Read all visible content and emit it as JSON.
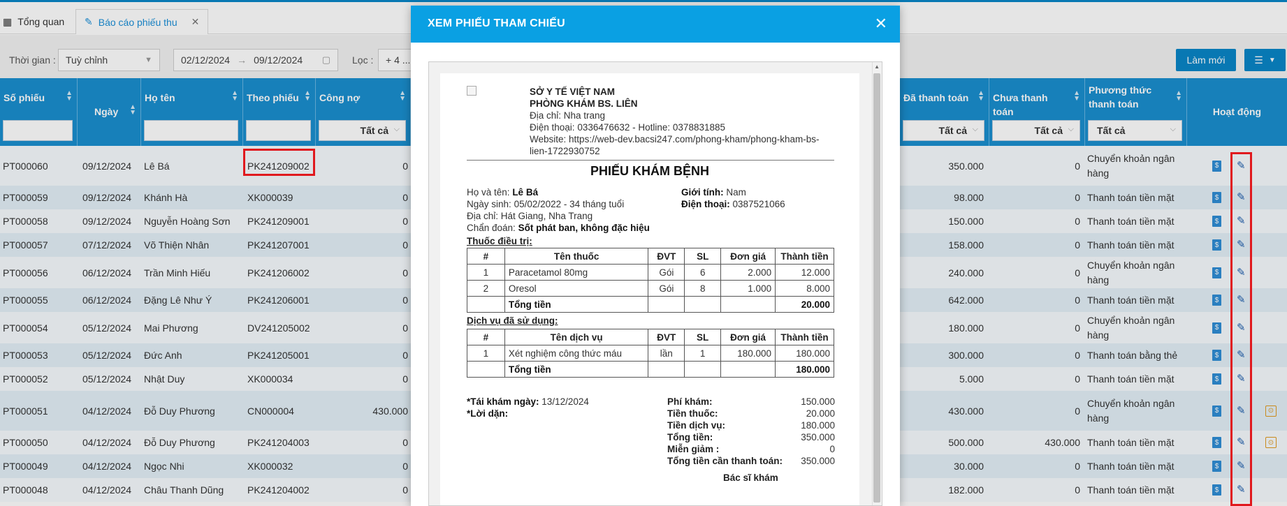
{
  "tabs": [
    {
      "label": "Tổng quan",
      "icon": "dashboard-icon"
    },
    {
      "label": "Báo cáo phiếu thu",
      "icon": "report-icon"
    }
  ],
  "filters": {
    "time_label": "Thời gian :",
    "time_value": "Tuỳ chỉnh",
    "date_from": "02/12/2024",
    "date_to": "09/12/2024",
    "filter_label": "Lọc :",
    "filter_value": "+ 4 ...",
    "refresh_label": "Làm mới"
  },
  "columns": [
    {
      "label": "Số phiếu"
    },
    {
      "label": "Ngày"
    },
    {
      "label": "Họ tên"
    },
    {
      "label": "Theo phiếu"
    },
    {
      "label": "Công nợ",
      "filter": "Tất cả"
    },
    {
      "label": "Đã thanh toán",
      "filter": "Tất cả"
    },
    {
      "label": "Chưa thanh toán",
      "filter": "Tất cả"
    },
    {
      "label": "Phương thức thanh toán",
      "filter": "Tất cả"
    },
    {
      "label": "Hoạt động"
    }
  ],
  "rows": [
    {
      "so": "PT000060",
      "ngay": "09/12/2024",
      "ten": "Lê Bá",
      "theo": "PK241209002",
      "congno": "0",
      "datt": "350.000",
      "chuatt": "0",
      "pt": "Chuyển khoản ngân hàng",
      "extra": false
    },
    {
      "so": "PT000059",
      "ngay": "09/12/2024",
      "ten": "Khánh Hà",
      "theo": "XK000039",
      "congno": "0",
      "datt": "98.000",
      "chuatt": "0",
      "pt": "Thanh toán tiền mặt",
      "extra": false
    },
    {
      "so": "PT000058",
      "ngay": "09/12/2024",
      "ten": "Nguyễn Hoàng Sơn",
      "theo": "PK241209001",
      "congno": "0",
      "datt": "150.000",
      "chuatt": "0",
      "pt": "Thanh toán tiền mặt",
      "extra": false
    },
    {
      "so": "PT000057",
      "ngay": "07/12/2024",
      "ten": "Võ Thiện Nhân",
      "theo": "PK241207001",
      "congno": "0",
      "datt": "158.000",
      "chuatt": "0",
      "pt": "Thanh toán tiền mặt",
      "extra": false
    },
    {
      "so": "PT000056",
      "ngay": "06/12/2024",
      "ten": "Trần Minh Hiếu",
      "theo": "PK241206002",
      "congno": "0",
      "datt": "240.000",
      "chuatt": "0",
      "pt": "Chuyển khoản ngân hàng",
      "extra": false
    },
    {
      "so": "PT000055",
      "ngay": "06/12/2024",
      "ten": "Đặng Lê Như Ý",
      "theo": "PK241206001",
      "congno": "0",
      "datt": "642.000",
      "chuatt": "0",
      "pt": "Thanh toán tiền mặt",
      "extra": false
    },
    {
      "so": "PT000054",
      "ngay": "05/12/2024",
      "ten": "Mai Phương",
      "theo": "DV241205002",
      "congno": "0",
      "datt": "180.000",
      "chuatt": "0",
      "pt": "Chuyển khoản ngân hàng",
      "extra": false
    },
    {
      "so": "PT000053",
      "ngay": "05/12/2024",
      "ten": "Đức Anh",
      "theo": "PK241205001",
      "congno": "0",
      "datt": "300.000",
      "chuatt": "0",
      "pt": "Thanh toán bằng thẻ",
      "extra": false
    },
    {
      "so": "PT000052",
      "ngay": "05/12/2024",
      "ten": "Nhật Duy",
      "theo": "XK000034",
      "congno": "0",
      "datt": "5.000",
      "chuatt": "0",
      "pt": "Thanh toán tiền mặt",
      "extra": false
    },
    {
      "so": "PT000051",
      "ngay": "04/12/2024",
      "ten": "Đỗ Duy Phương",
      "theo": "CN000004",
      "congno": "430.000",
      "datt": "430.000",
      "chuatt": "0",
      "pt": "Chuyển khoản ngân hàng",
      "extra": true
    },
    {
      "so": "PT000050",
      "ngay": "04/12/2024",
      "ten": "Đỗ Duy Phương",
      "theo": "PK241204003",
      "congno": "0",
      "datt": "500.000",
      "chuatt": "430.000",
      "pt": "Thanh toán tiền mặt",
      "extra": true
    },
    {
      "so": "PT000049",
      "ngay": "04/12/2024",
      "ten": "Ngọc Nhi",
      "theo": "XK000032",
      "congno": "0",
      "datt": "30.000",
      "chuatt": "0",
      "pt": "Thanh toán tiền mặt",
      "extra": false
    },
    {
      "so": "PT000048",
      "ngay": "04/12/2024",
      "ten": "Châu Thanh Dũng",
      "theo": "PK241204002",
      "congno": "0",
      "datt": "182.000",
      "chuatt": "0",
      "pt": "Thanh toán tiền mặt",
      "extra": false
    }
  ],
  "modal": {
    "title": "XEM PHIẾU THAM CHIẾU",
    "clinic": {
      "dept": "SỞ Y TẾ VIỆT NAM",
      "name": "PHÒNG KHÁM BS. LIÊN",
      "address_label": "Địa chỉ:",
      "address": "Nha trang",
      "phone_label": "Điện thoại:",
      "phone": "0336476632 - Hotline: 0378831885",
      "website_label": "Website:",
      "website": "https://web-dev.bacsi247.com/phong-kham/phong-kham-bs-",
      "website2": "lien-1722930752"
    },
    "doc_title": "PHIẾU KHÁM BỆNH",
    "patient": {
      "name_label": "Họ và tên:",
      "name": "Lê Bá",
      "dob_label": "Ngày sinh:",
      "dob": "05/02/2022 - 34 tháng tuổi",
      "addr_label": "Địa chỉ:",
      "addr": "Hát Giang, Nha Trang",
      "diag_label": "Chẩn đoán:",
      "diag": "Sốt phát ban, không đặc hiệu",
      "sex_label": "Giới tính:",
      "sex": "Nam",
      "phone_label": "Điện thoại:",
      "phone": "0387521066"
    },
    "drugs_title": "Thuốc điều trị:",
    "drugs_head": [
      "#",
      "Tên thuốc",
      "ĐVT",
      "SL",
      "Đơn giá",
      "Thành tiền"
    ],
    "drugs": [
      [
        "1",
        "Paracetamol 80mg",
        "Gói",
        "6",
        "2.000",
        "12.000"
      ],
      [
        "2",
        "Oresol",
        "Gói",
        "8",
        "1.000",
        "8.000"
      ]
    ],
    "drugs_total_label": "Tổng tiền",
    "drugs_total": "20.000",
    "services_title": "Dịch vụ đã sử dụng:",
    "services_head": [
      "#",
      "Tên dịch vụ",
      "ĐVT",
      "SL",
      "Đơn giá",
      "Thành tiền"
    ],
    "services": [
      [
        "1",
        "Xét nghiệm công thức máu",
        "lần",
        "1",
        "180.000",
        "180.000"
      ]
    ],
    "services_total_label": "Tổng tiền",
    "services_total": "180.000",
    "reexam_label": "*Tái khám ngày:",
    "reexam_date": "13/12/2024",
    "advice_label": "*Lời dặn:",
    "summary": [
      {
        "label": "Phí khám:",
        "value": "150.000"
      },
      {
        "label": "Tiền thuốc:",
        "value": "20.000"
      },
      {
        "label": "Tiền dịch vụ:",
        "value": "180.000"
      },
      {
        "label": "Tổng tiền:",
        "value": "350.000"
      },
      {
        "label": "Miễn giảm :",
        "value": "0"
      },
      {
        "label": "Tổng tiền cần thanh toán:",
        "value": "350.000"
      }
    ],
    "doctor_label": "Bác sĩ khám"
  }
}
